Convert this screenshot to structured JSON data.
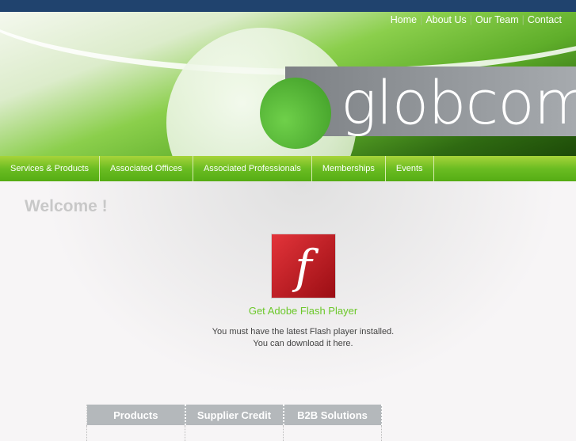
{
  "header": {
    "logo_text": "globcom",
    "top_links": [
      "Home",
      "About Us",
      "Our Team",
      "Contact"
    ]
  },
  "nav": [
    "Services & Products",
    "Associated Offices",
    "Associated Professionals",
    "Memberships",
    "Events"
  ],
  "main": {
    "welcome": "Welcome !",
    "flash_link": "Get Adobe Flash Player",
    "message_line1": "You must have the latest Flash player installed.",
    "message_line2": "You can download it here."
  },
  "table": {
    "headers": [
      "Products",
      "Supplier Credit",
      "B2B Solutions"
    ]
  }
}
